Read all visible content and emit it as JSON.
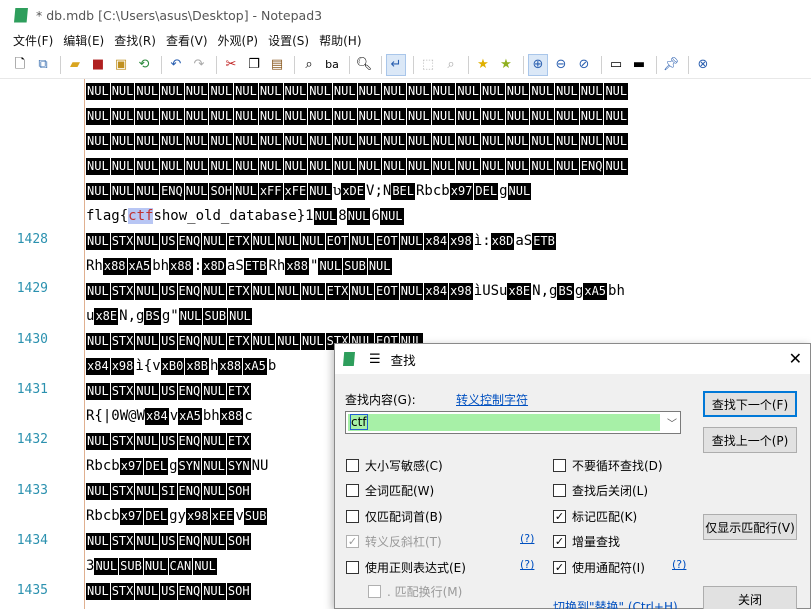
{
  "window": {
    "title": "* db.mdb [C:\\Users\\asus\\Desktop] - Notepad3"
  },
  "menu": [
    "文件(F)",
    "编辑(E)",
    "查找(R)",
    "查看(V)",
    "外观(P)",
    "设置(S)",
    "帮助(H)"
  ],
  "toolbar": [
    "new-file",
    "new-window",
    "open",
    "save",
    "save-as",
    "revert",
    "undo",
    "redo",
    "cut",
    "copy",
    "paste",
    "find",
    "replace",
    "goto",
    "word-wrap",
    "select",
    "find-next",
    "bookmark",
    "bookmark-all",
    "zoom-in",
    "zoom-out",
    "zoom-reset",
    "settings",
    "console",
    "pin",
    "close"
  ],
  "line_numbers": [
    "1428",
    "1429",
    "1430",
    "1431",
    "1432",
    "1433",
    "1434",
    "1435"
  ],
  "lines": [
    "NUL NUL NUL NUL NUL NUL NUL NUL NUL NUL NUL NUL NUL NUL NUL NUL NUL NUL NUL NUL NUL NUL",
    "NUL NUL NUL NUL NUL NUL NUL NUL NUL NUL NUL NUL NUL NUL NUL NUL NUL NUL NUL NUL NUL NUL",
    "NUL NUL NUL NUL NUL NUL NUL NUL NUL NUL NUL NUL NUL NUL NUL NUL NUL NUL NUL NUL NUL NUL",
    "NUL NUL NUL NUL NUL NUL NUL NUL NUL NUL NUL NUL NUL NUL NUL NUL NUL NUL NUL NUL ENQ NUL",
    "NUL NUL NUL ENQ NUL SOH NUL xFF xFE NUL ʋ xDE V ; N BEL Rbcb x97 DEL g NUL",
    "flag{ ctf show_old_database}1 NUL 8 NUL 6 NUL",
    "NUL STX NUL US ENQ NUL ETX NUL NUL NUL EOT NUL EOT NUL x84 x98 ì: x8D a S ETB",
    "Rh x88 xA5 bh x88 : x8D a S ETB Rh x88 \" NUL SUB NUL",
    "NUL STX NUL US ENQ NUL ETX NUL NUL NUL ETX NUL EOT NUL x84 x98 ìUSu x8E N ,g BS g xA5 bh",
    "u x8E N ,g BS g\" NUL SUB NUL",
    "NUL STX NUL US ENQ NUL ETX NUL NUL NUL STX NUL EOT NUL",
    "x84 x98 ì{v xB0 x8B h x88 xA5 b",
    "NUL STX NUL US ENQ NUL ETX",
    "R{|0W@W x84 v xA5 bh x88  c",
    "NUL STX NUL US ENQ NUL ETX",
    "Rbcb x97 DEL g SYN NUL SYN NU",
    "NUL STX NUL SI ENQ NUL SOH",
    "Rbcb x97 DEL gy x98 xEE v SUB",
    "NUL STX NUL US ENQ NUL SOH",
    "3 NUL SUB NUL CAN NUL",
    "NUL STX NUL US ENQ NUL SOH"
  ],
  "find": {
    "menu_glyph": "☰",
    "title": "查找",
    "close_glyph": "✕",
    "label": "查找内容(G):",
    "link": "转义控制字符",
    "value": "ctf",
    "find_next": "查找下一个(F)",
    "find_prev": "查找上一个(P)",
    "show_matches": "仅显示匹配行(V)",
    "close": "关闭",
    "replace_link": "切换到\"替换\" (Ctrl+H)",
    "help": "(?)",
    "options_left": [
      {
        "label": "大小写敏感(C)",
        "checked": false,
        "disabled": false
      },
      {
        "label": "全词匹配(W)",
        "checked": false,
        "disabled": false
      },
      {
        "label": "仅匹配词首(B)",
        "checked": false,
        "disabled": false
      },
      {
        "label": "转义反斜杠(T)",
        "checked": true,
        "disabled": true
      },
      {
        "label": "使用正则表达式(E)",
        "checked": false,
        "disabled": false
      },
      {
        "label": ". 匹配换行(M)",
        "checked": false,
        "disabled": true
      }
    ],
    "options_right": [
      {
        "label": "不要循环查找(D)",
        "checked": false
      },
      {
        "label": "查找后关闭(L)",
        "checked": false
      },
      {
        "label": "标记匹配(K)",
        "checked": true
      },
      {
        "label": "增量查找",
        "checked": true
      },
      {
        "label": "使用通配符(I)",
        "checked": true
      }
    ]
  },
  "colors": {
    "line_number": "#2b91af",
    "control_char_bg": "#000000",
    "match_highlight": "#b8c6f4",
    "find_input_bg": "#a7f0a7",
    "link": "#0050c0"
  }
}
